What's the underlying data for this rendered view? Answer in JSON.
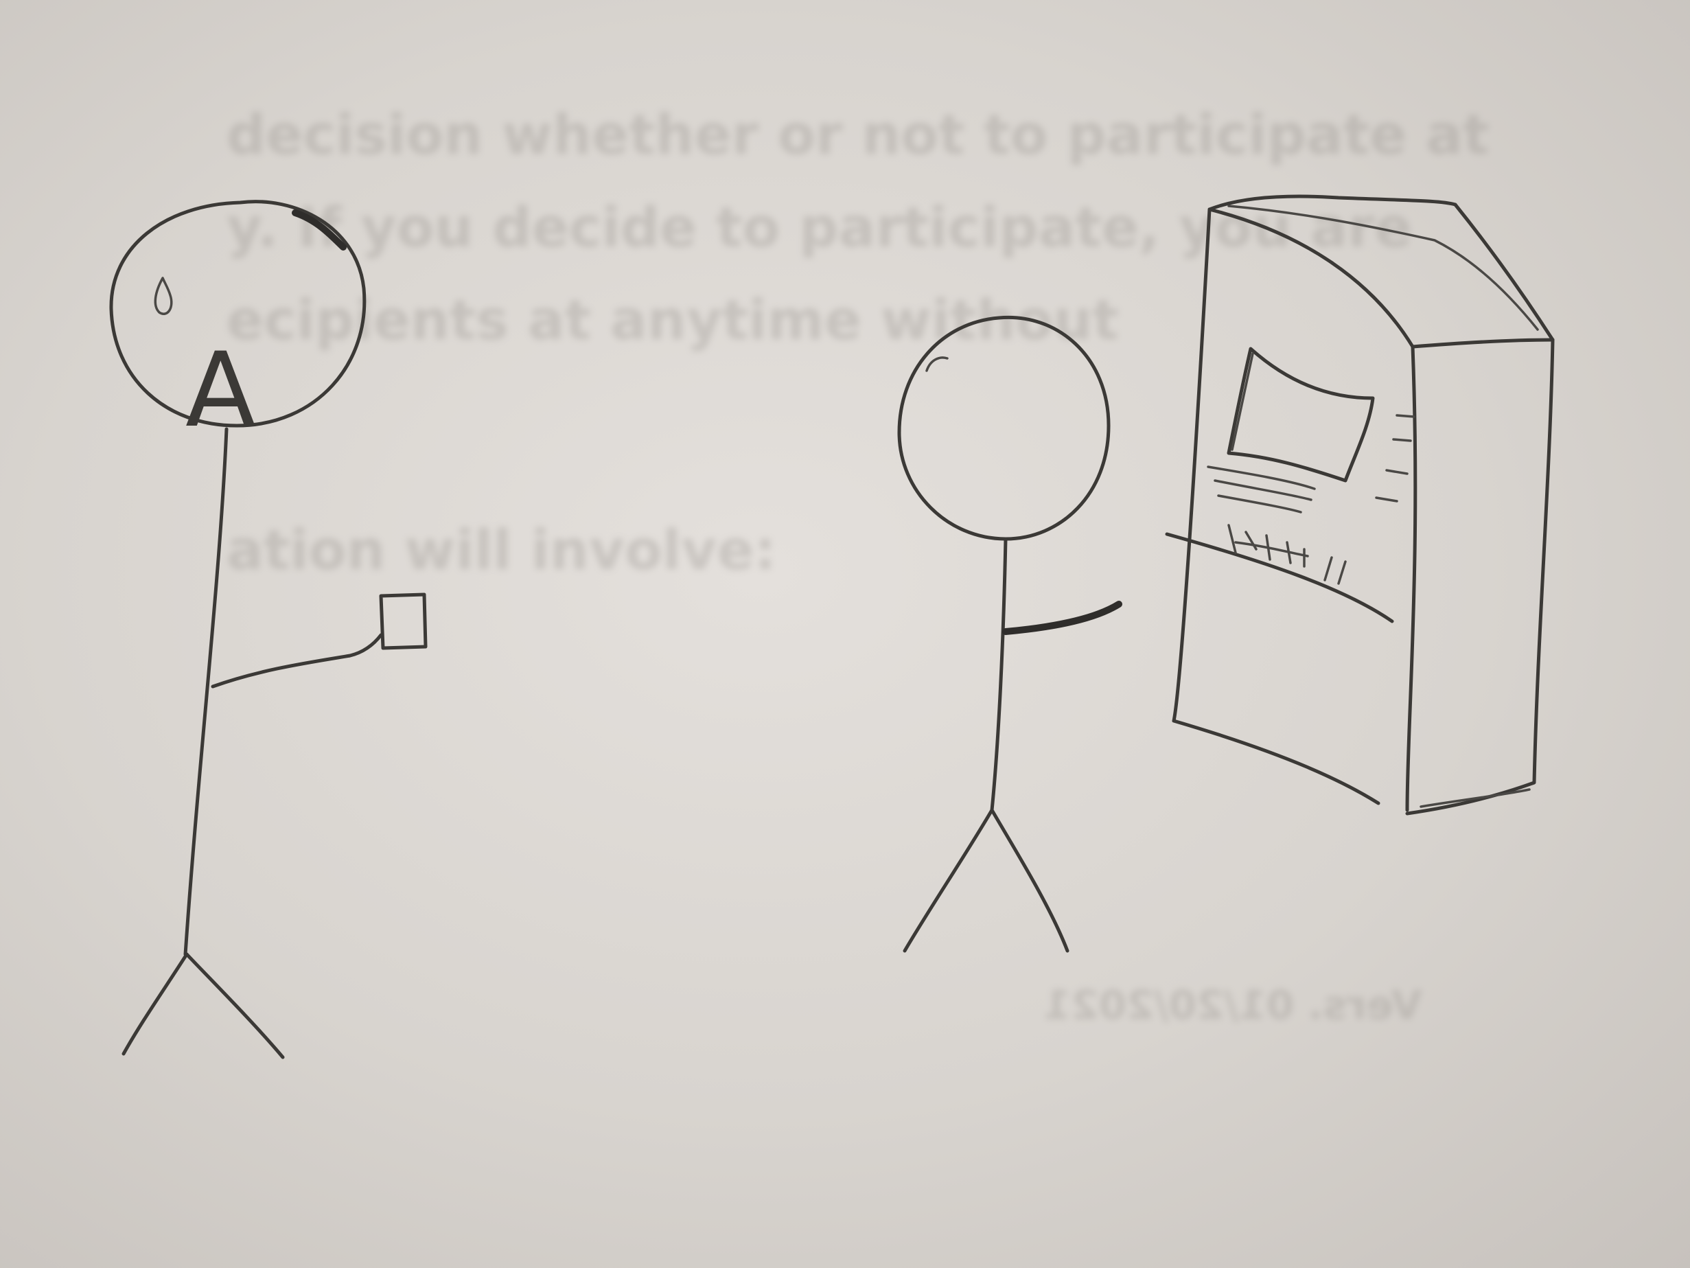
{
  "figure_a": {
    "head_letter": "A"
  },
  "bleed_through": {
    "lines": [
      "decision whether or not to participate at",
      "y. If you decide to participate, you are",
      "ecipients at anytime without",
      "ation will involve:"
    ],
    "mirrored_footer": "Vers. 01/20/2021"
  }
}
